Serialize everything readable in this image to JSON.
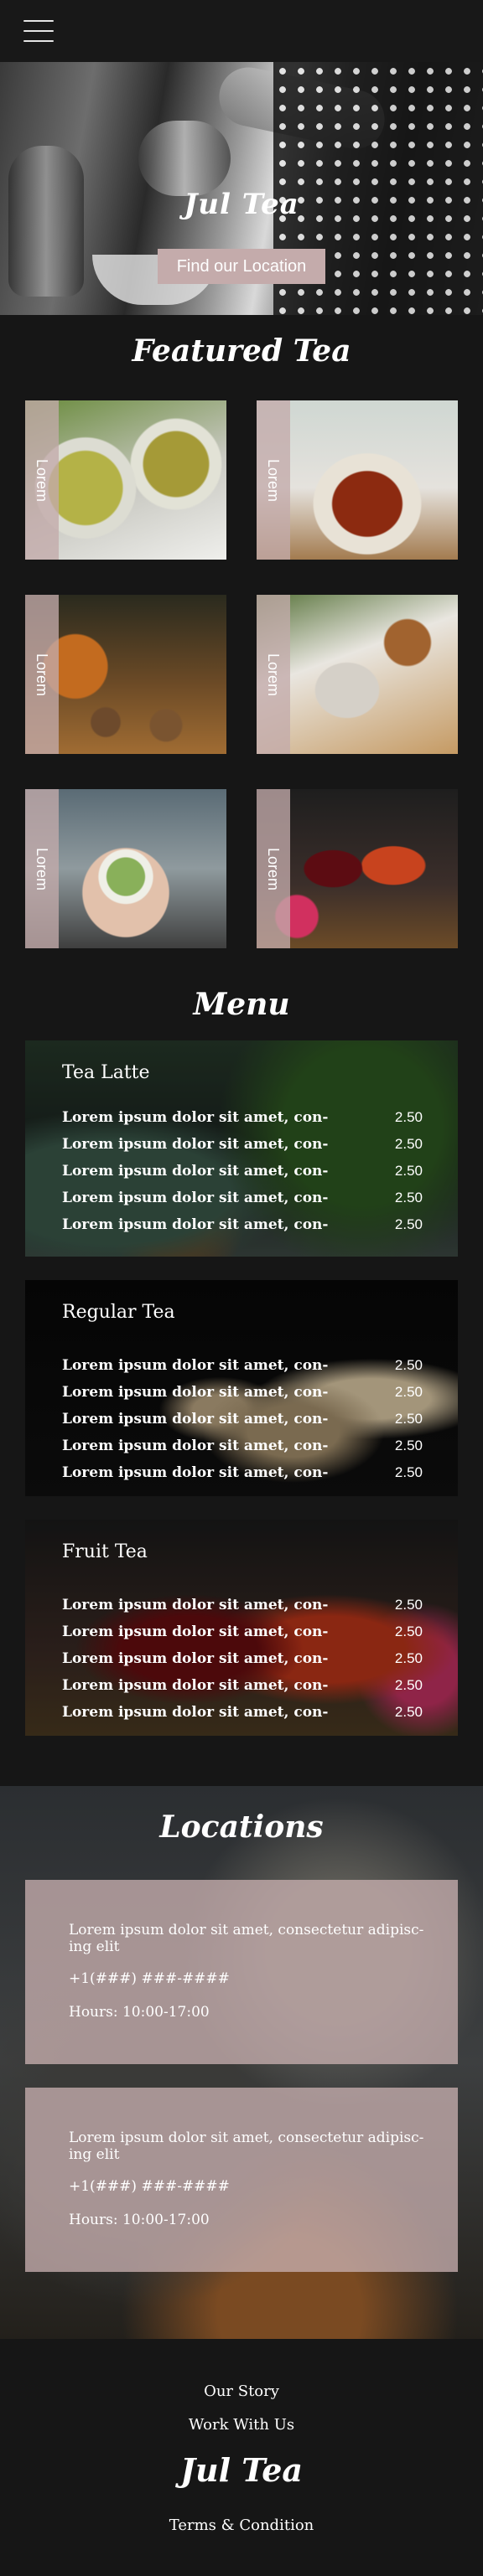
{
  "hero": {
    "logo": "Jul Tea",
    "button_label": "Find our Location"
  },
  "featured": {
    "title": "Featured Tea",
    "tiles": [
      {
        "label": "Lorem"
      },
      {
        "label": "Lorem"
      },
      {
        "label": "Lorem"
      },
      {
        "label": "Lorem"
      },
      {
        "label": "Lorem"
      },
      {
        "label": "Lorem"
      }
    ]
  },
  "menu": {
    "title": "Menu",
    "sections": [
      {
        "title": "Tea Latte",
        "items": [
          {
            "name": "Lorem ipsum dolor sit amet, con-",
            "price": "2.50"
          },
          {
            "name": "Lorem ipsum dolor sit amet, con-",
            "price": "2.50"
          },
          {
            "name": "Lorem ipsum dolor sit amet, con-",
            "price": "2.50"
          },
          {
            "name": "Lorem ipsum dolor sit amet, con-",
            "price": "2.50"
          },
          {
            "name": "Lorem ipsum dolor sit amet, con-",
            "price": "2.50"
          }
        ]
      },
      {
        "title": "Regular Tea",
        "items": [
          {
            "name": "Lorem ipsum dolor sit amet, con-",
            "price": "2.50"
          },
          {
            "name": "Lorem ipsum dolor sit amet, con-",
            "price": "2.50"
          },
          {
            "name": "Lorem ipsum dolor sit amet, con-",
            "price": "2.50"
          },
          {
            "name": "Lorem ipsum dolor sit amet, con-",
            "price": "2.50"
          },
          {
            "name": "Lorem ipsum dolor sit amet, con-",
            "price": "2.50"
          }
        ]
      },
      {
        "title": "Fruit Tea",
        "items": [
          {
            "name": "Lorem ipsum dolor sit amet, con-",
            "price": "2.50"
          },
          {
            "name": "Lorem ipsum dolor sit amet, con-",
            "price": "2.50"
          },
          {
            "name": "Lorem ipsum dolor sit amet, con-",
            "price": "2.50"
          },
          {
            "name": "Lorem ipsum dolor sit amet, con-",
            "price": "2.50"
          },
          {
            "name": "Lorem ipsum dolor sit amet, con-",
            "price": "2.50"
          }
        ]
      }
    ]
  },
  "locations": {
    "title": "Locations",
    "cards": [
      {
        "address": "Lorem ipsum dolor sit amet, consectetur adipisc- ing elit",
        "phone": "+1(###) ###-####",
        "hours": "Hours: 10:00-17:00"
      },
      {
        "address": "Lorem ipsum dolor sit amet, consectetur adipisc- ing elit",
        "phone": "+1(###) ###-####",
        "hours": "Hours: 10:00-17:00"
      }
    ]
  },
  "footer": {
    "links": [
      "Our Story",
      "Work With Us"
    ],
    "logo": "Jul Tea",
    "terms": "Terms & Condition"
  },
  "colors": {
    "background": "#161616",
    "accent_pink": "#c4abab",
    "text": "#ffffff"
  },
  "icons": {
    "menu": "hamburger-icon"
  }
}
